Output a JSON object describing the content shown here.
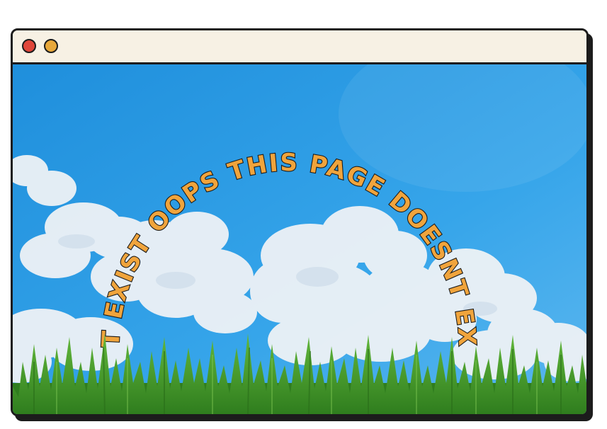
{
  "window": {
    "controls": [
      {
        "name": "close-button",
        "color": "#e0463a"
      },
      {
        "name": "minimize-button",
        "color": "#e8a83a"
      }
    ]
  },
  "scene": {
    "sky_color": "#2f9ee3",
    "cloud_color": "#f2f4f7",
    "grass_color": "#3f9a2a",
    "arc_text_color": "#f0a43c",
    "arc_text": "T EXIST  OOPS THIS PAGE DOESNT EXIS"
  }
}
